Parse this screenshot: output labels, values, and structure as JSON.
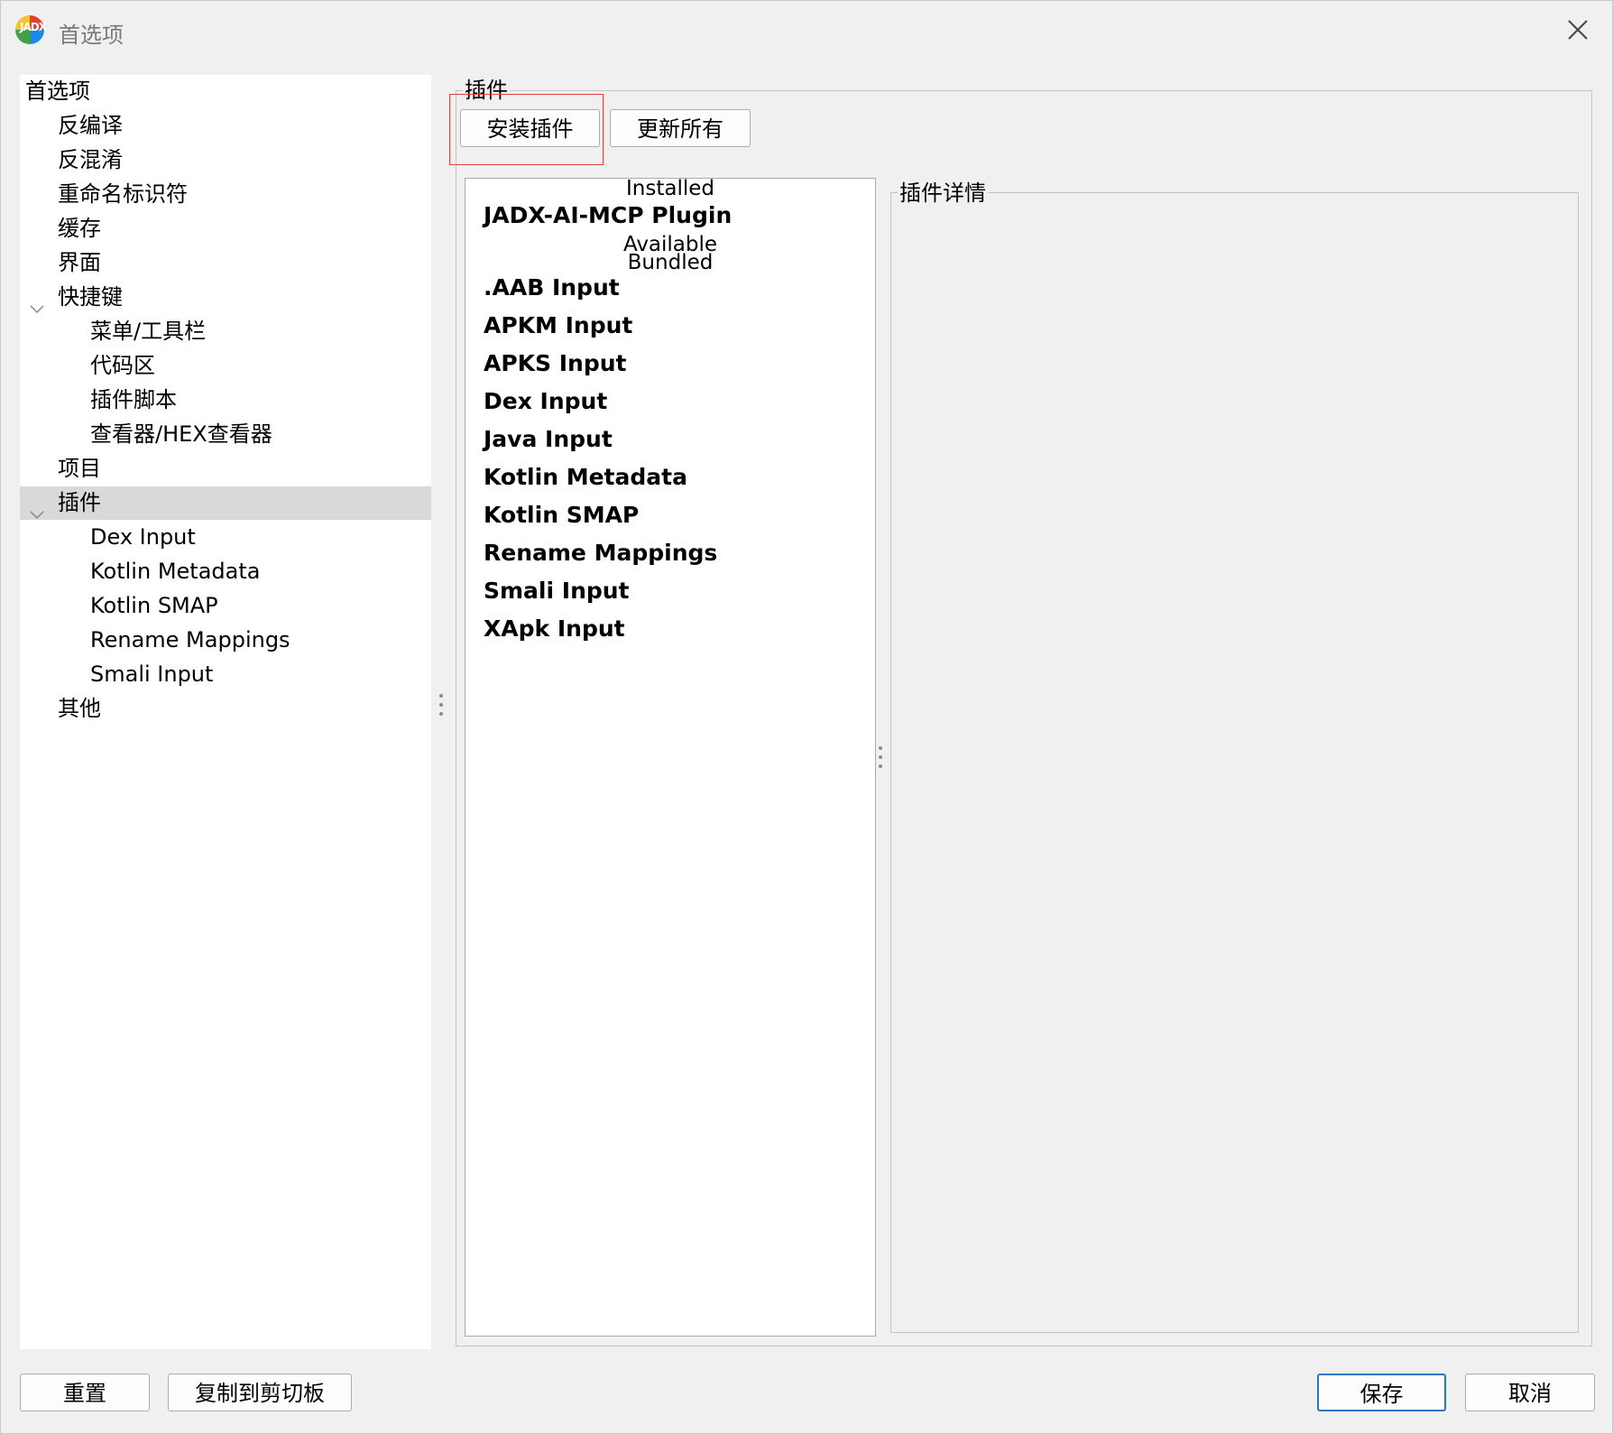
{
  "window": {
    "title": "首选项",
    "icon": "jadx-app-icon",
    "icon_text": "JADX"
  },
  "tree": {
    "items": [
      {
        "label": "首选项",
        "level": 0
      },
      {
        "label": "反编译",
        "level": 1
      },
      {
        "label": "反混淆",
        "level": 1
      },
      {
        "label": "重命名标识符",
        "level": 1
      },
      {
        "label": "缓存",
        "level": 1
      },
      {
        "label": "界面",
        "level": 1
      },
      {
        "label": "快捷键",
        "level": 1,
        "expanded": true
      },
      {
        "label": "菜单/工具栏",
        "level": 2
      },
      {
        "label": "代码区",
        "level": 2
      },
      {
        "label": "插件脚本",
        "level": 2
      },
      {
        "label": "查看器/HEX查看器",
        "level": 2
      },
      {
        "label": "项目",
        "level": 1
      },
      {
        "label": "插件",
        "level": 1,
        "expanded": true,
        "selected": true
      },
      {
        "label": "Dex Input",
        "level": 2
      },
      {
        "label": "Kotlin Metadata",
        "level": 2
      },
      {
        "label": "Kotlin SMAP",
        "level": 2
      },
      {
        "label": "Rename Mappings",
        "level": 2
      },
      {
        "label": "Smali Input",
        "level": 2
      },
      {
        "label": "其他",
        "level": 1
      }
    ]
  },
  "plugins": {
    "group_title": "插件",
    "install_button": "安装插件",
    "update_all_button": "更新所有",
    "details_title": "插件详情",
    "sections": {
      "installed": "Installed",
      "available": "Available",
      "bundled": "Bundled"
    },
    "installed": [
      "JADX-AI-MCP Plugin"
    ],
    "bundled": [
      ".AAB Input",
      "APKM Input",
      "APKS Input",
      "Dex Input",
      "Java Input",
      "Kotlin Metadata",
      "Kotlin SMAP",
      "Rename Mappings",
      "Smali Input",
      "XApk Input"
    ]
  },
  "footer": {
    "reset_button": "重置",
    "copy_button": "复制到剪切板",
    "save_button": "保存",
    "cancel_button": "取消"
  },
  "colors": {
    "selection": "#d9d9d9",
    "focus_outline": "#e04040",
    "primary_border": "#2f73c8"
  }
}
